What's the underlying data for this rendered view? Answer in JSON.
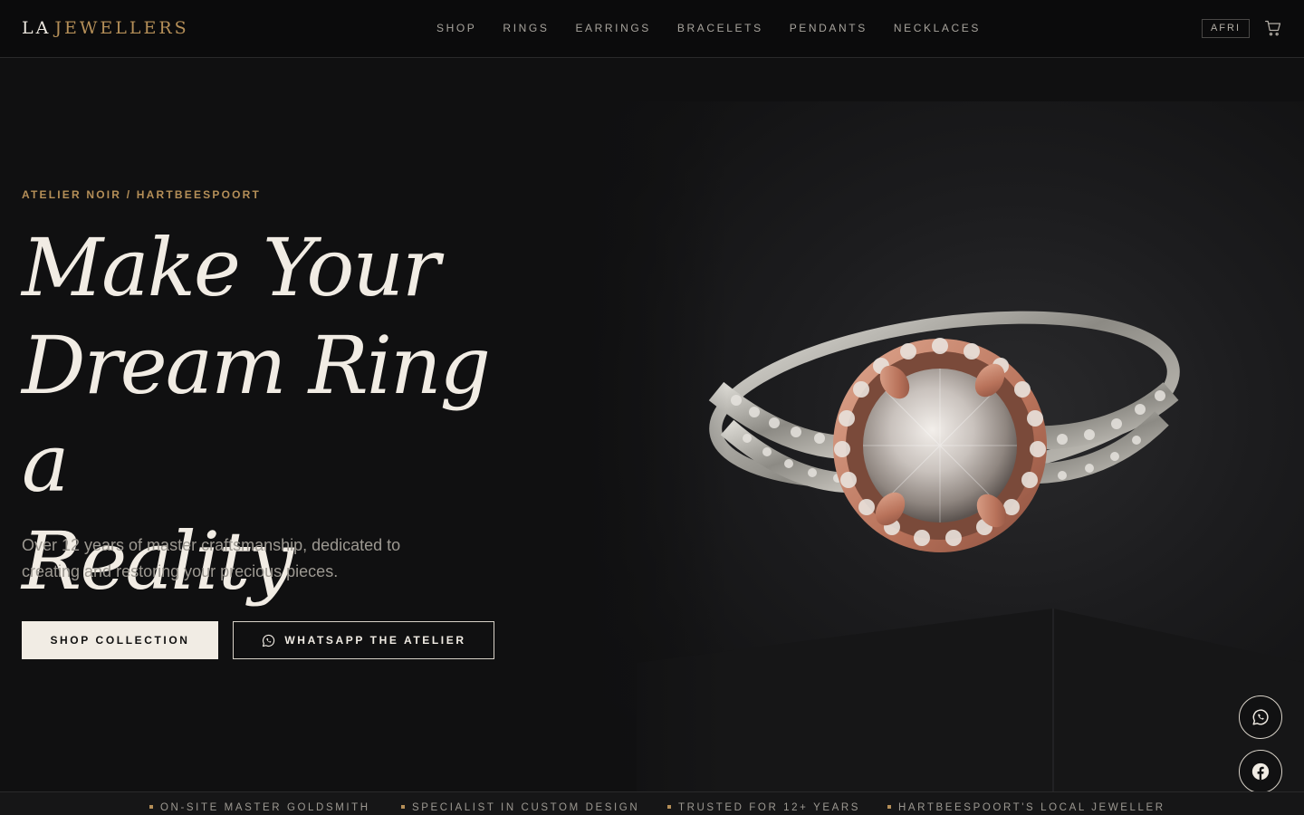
{
  "header": {
    "logo_prefix": "LA",
    "logo_suffix": "JEWELLERS",
    "nav": [
      "SHOP",
      "RINGS",
      "EARRINGS",
      "BRACELETS",
      "PENDANTS",
      "NECKLACES"
    ],
    "language": "AFRI",
    "cart_icon": "cart-icon"
  },
  "hero": {
    "eyebrow": "ATELIER NOIR / HARTBEESPOORT",
    "headline_line1": "Make Your",
    "headline_line2": "Dream Ring a",
    "headline_line3": "Reality",
    "subtitle": "Over 12 years of master craftsmanship, dedicated to creating and restoring your precious pieces.",
    "primary_button": "SHOP COLLECTION",
    "secondary_button": "WHATSAPP THE ATELIER",
    "image": "rose-gold halo diamond engagement ring on dark surface"
  },
  "floating": {
    "whatsapp_icon": "whatsapp-icon",
    "facebook_icon": "facebook-icon"
  },
  "trust_strip": [
    "ON-SITE MASTER GOLDSMITH",
    "SPECIALIST IN CUSTOM DESIGN",
    "TRUSTED FOR 12+ YEARS",
    "HARTBEESPOORT'S LOCAL JEWELLER"
  ],
  "colors": {
    "accent": "#b58f58",
    "background": "#101011",
    "text": "#f1ece4",
    "muted": "#9c9891"
  }
}
